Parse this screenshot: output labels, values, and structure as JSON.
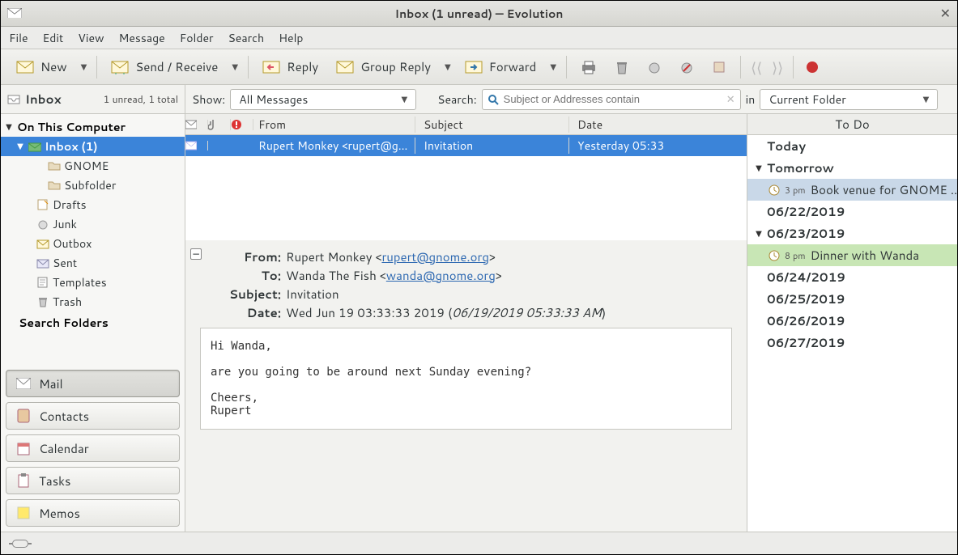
{
  "window": {
    "title": "Inbox (1 unread) — Evolution"
  },
  "menu": [
    "File",
    "Edit",
    "View",
    "Message",
    "Folder",
    "Search",
    "Help"
  ],
  "toolbar": {
    "new": "New",
    "sendreceive": "Send / Receive",
    "reply": "Reply",
    "groupreply": "Group Reply",
    "forward": "Forward"
  },
  "filter": {
    "folder_label": "Inbox",
    "folder_status": "1 unread, 1 total",
    "show_label": "Show:",
    "show_value": "All Messages",
    "search_label": "Search:",
    "search_placeholder": "Subject or Addresses contain",
    "in_label": "in",
    "in_value": "Current Folder"
  },
  "folders": {
    "root": "On This Computer",
    "inbox": "Inbox (1)",
    "gnome": "GNOME",
    "subfolder": "Subfolder",
    "drafts": "Drafts",
    "junk": "Junk",
    "outbox": "Outbox",
    "sent": "Sent",
    "templates": "Templates",
    "trash": "Trash",
    "search": "Search Folders"
  },
  "switcher": {
    "mail": "Mail",
    "contacts": "Contacts",
    "calendar": "Calendar",
    "tasks": "Tasks",
    "memos": "Memos"
  },
  "list_headers": {
    "from": "From",
    "subject": "Subject",
    "date": "Date"
  },
  "message": {
    "from_col": "Rupert Monkey <rupert@g…",
    "subject_col": "Invitation",
    "date_col": "Yesterday 05:33"
  },
  "headers": {
    "from_k": "From:",
    "from_name": "Rupert Monkey <",
    "from_mail": "rupert@gnome.org",
    "from_close": ">",
    "to_k": "To:",
    "to_name": "Wanda The Fish <",
    "to_mail": "wanda@gnome.org",
    "to_close": ">",
    "subj_k": "Subject:",
    "subj_v": "Invitation",
    "date_k": "Date:",
    "date_v1": "Wed Jun 19 03:33:33 2019 (",
    "date_v2": "06/19/2019 05:33:33 AM",
    "date_v3": ")"
  },
  "body": "Hi Wanda,\n\nare you going to be around next Sunday evening?\n\nCheers,\nRupert",
  "todo": {
    "title": "To Do",
    "today": "Today",
    "tomorrow": "Tomorrow",
    "t1_time": "3 pm",
    "t1_text": "Book venue for GNOME …",
    "d1": "06/22/2019",
    "d2": "06/23/2019",
    "t2_time": "8 pm",
    "t2_text": "Dinner with Wanda",
    "d3": "06/24/2019",
    "d4": "06/25/2019",
    "d5": "06/26/2019",
    "d6": "06/27/2019"
  }
}
